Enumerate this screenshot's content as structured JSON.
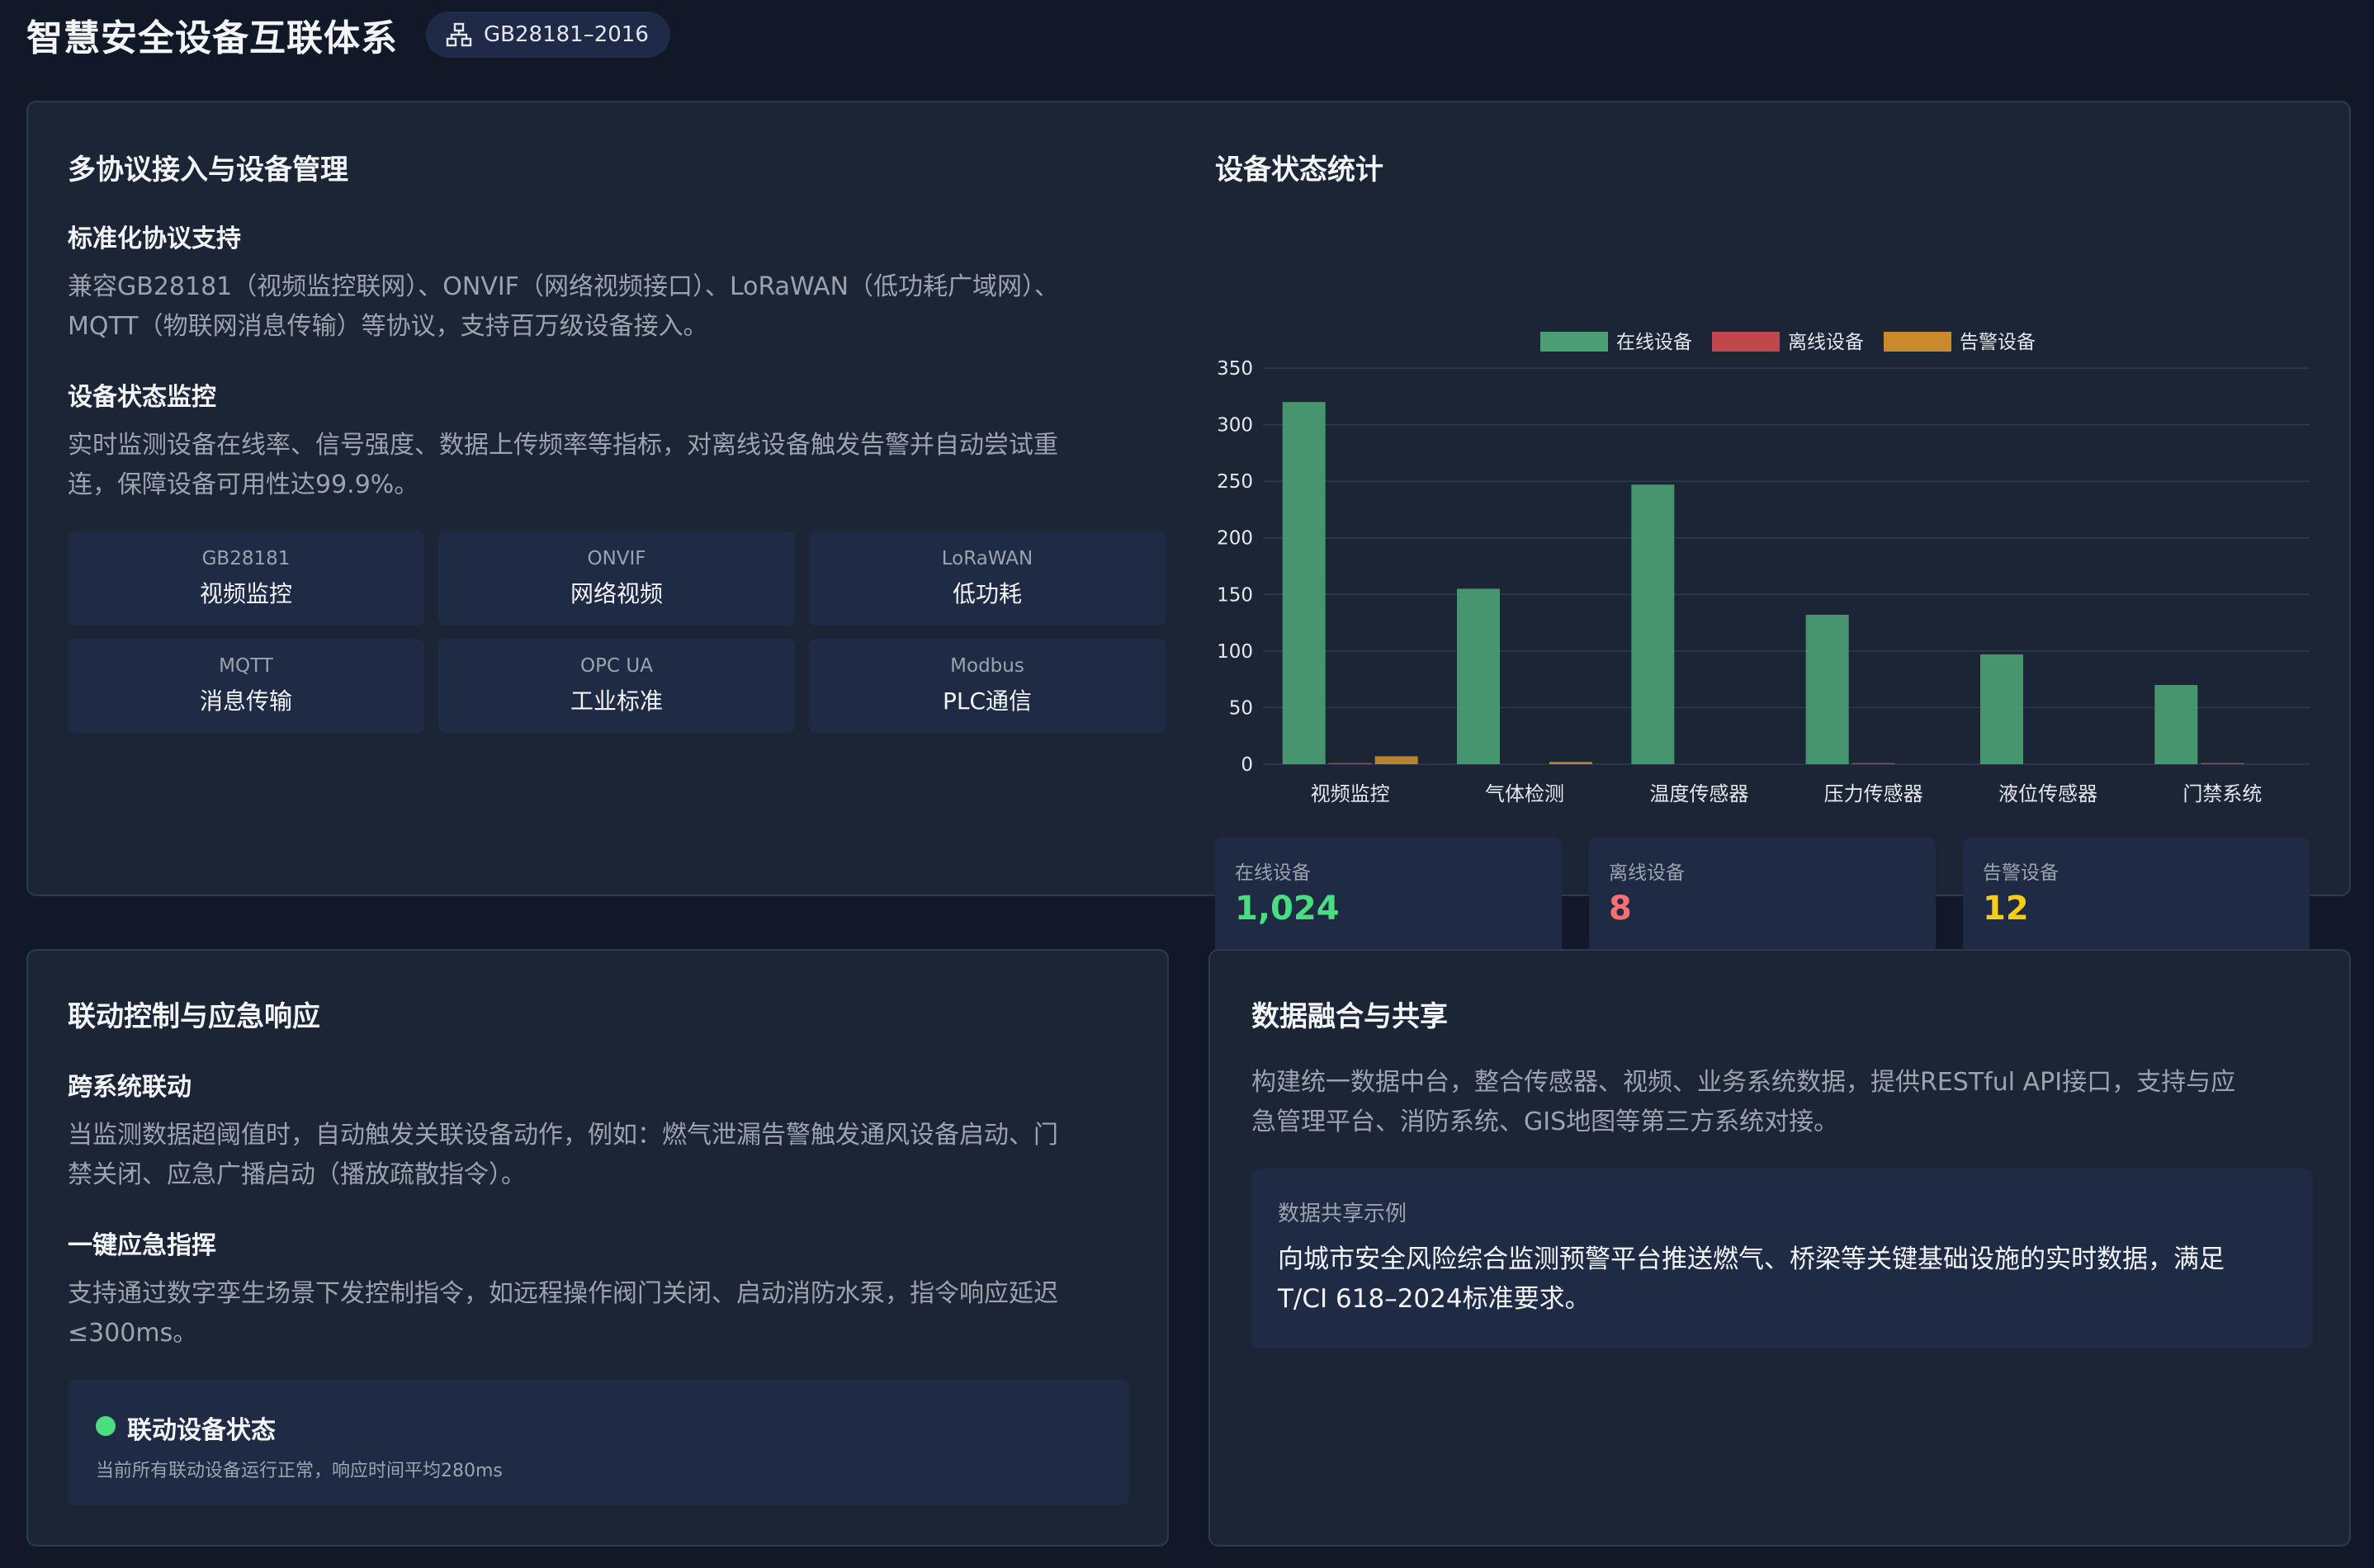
{
  "header": {
    "title": "智慧安全设备互联体系",
    "badge": "GB28181–2016",
    "badge_icon": "network-icon"
  },
  "protocol_panel": {
    "title": "多协议接入与设备管理",
    "section1_title": "标准化协议支持",
    "section1_line1": "兼容GB28181（视频监控联网）、ONVIF（网络视频接口）、LoRaWAN（低功耗广域网）、",
    "section1_line2": "MQTT（物联网消息传输）等协议，支持百万级设备接入。",
    "section2_title": "设备状态监控",
    "section2_line1": "实时监测设备在线率、信号强度、数据上传频率等指标，对离线设备触发告警并自动尝试重",
    "section2_line2": "连，保障设备可用性达99.9%。",
    "protocols": [
      {
        "code": "GB28181",
        "name": "视频监控"
      },
      {
        "code": "ONVIF",
        "name": "网络视频"
      },
      {
        "code": "LoRaWAN",
        "name": "低功耗"
      },
      {
        "code": "MQTT",
        "name": "消息传输"
      },
      {
        "code": "OPC UA",
        "name": "工业标准"
      },
      {
        "code": "Modbus",
        "name": "PLC通信"
      }
    ]
  },
  "status_panel": {
    "title": "设备状态统计",
    "stats": [
      {
        "label": "在线设备",
        "value": "1,024"
      },
      {
        "label": "离线设备",
        "value": "8"
      },
      {
        "label": "告警设备",
        "value": "12"
      }
    ]
  },
  "chart_data": {
    "type": "bar",
    "categories": [
      "视频监控",
      "气体检测",
      "温度传感器",
      "压力传感器",
      "液位传感器",
      "门禁系统"
    ],
    "series": [
      {
        "name": "在线设备",
        "values": [
          320,
          155,
          247,
          132,
          97,
          70
        ],
        "color": "#4a9e73"
      },
      {
        "name": "离线设备",
        "values": [
          1,
          0,
          0,
          1,
          0,
          1
        ],
        "color": "#c0474a"
      },
      {
        "name": "告警设备",
        "values": [
          7,
          2,
          0,
          0,
          0,
          0
        ],
        "color": "#c98a2e"
      }
    ],
    "ylim": [
      0,
      350
    ],
    "yticks": [
      "0",
      "50",
      "100",
      "150",
      "200",
      "250",
      "300",
      "350"
    ],
    "legend_position": "top-center",
    "grid": true
  },
  "linkage_panel": {
    "title": "联动控制与应急响应",
    "section1_title": "跨系统联动",
    "section1_line1": "当监测数据超阈值时，自动触发关联设备动作，例如：燃气泄漏告警触发通风设备启动、门",
    "section1_line2": "禁关闭、应急广播启动（播放疏散指令）。",
    "section2_title": "一键应急指挥",
    "section2_line1": "支持通过数字孪生场景下发控制指令，如远程操作阀门关闭、启动消防水泵，指令响应延迟",
    "section2_line2": "≤300ms。",
    "status_title": "联动设备状态",
    "status_text": "当前所有联动设备运行正常，响应时间平均280ms",
    "status_color": "#4ade80"
  },
  "data_panel": {
    "title": "数据融合与共享",
    "line1": "构建统一数据中台，整合传感器、视频、业务系统数据，提供RESTful API接口，支持与应",
    "line2": "急管理平台、消防系统、GIS地图等第三方系统对接。",
    "example_label": "数据共享示例",
    "example_line1": "向城市安全风险综合监测预警平台推送燃气、桥梁等关键基础设施的实时数据，满足",
    "example_line2": "T/CI 618–2024标准要求。"
  },
  "colors": {
    "online": "#4ade80",
    "offline": "#f87171",
    "warning": "#facc15"
  }
}
